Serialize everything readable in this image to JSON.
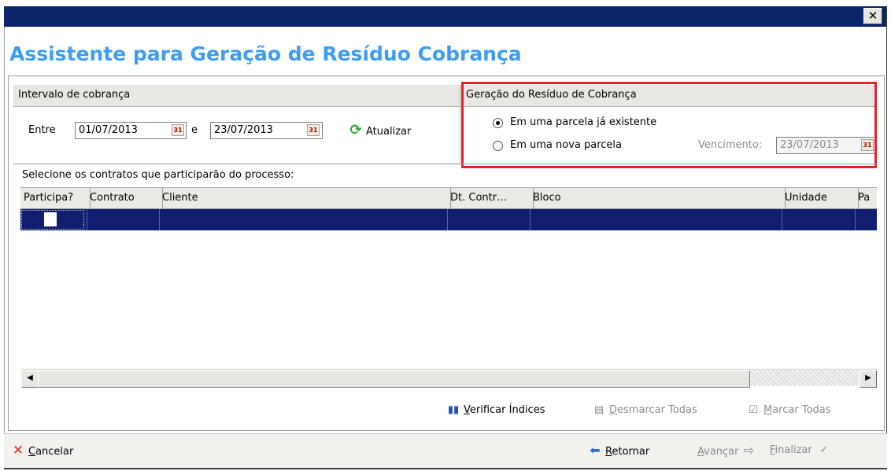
{
  "window": {
    "close_glyph": "✕"
  },
  "heading": "Assistente para Geração de Resíduo Cobrança",
  "intervalo": {
    "title": "Intervalo de cobrança",
    "entre_label": "Entre",
    "date_from": "01/07/2013",
    "e_label": "e",
    "date_to": "23/07/2013",
    "refresh_label": "Atualizar"
  },
  "geracao": {
    "title": "Geração do Resíduo de Cobrança",
    "option_existing": "Em uma parcela já existente",
    "option_new": "Em uma nova parcela",
    "selected": "existing",
    "vencimento_label": "Vencimento:",
    "vencimento_date": "23/07/2013"
  },
  "contratos": {
    "prompt": "Selecione os contratos que participarão do processo:",
    "columns": [
      "Participa?",
      "Contrato",
      "Cliente",
      "Dt. Contr…",
      "Bloco",
      "Unidade",
      "Pa"
    ]
  },
  "actions": {
    "verificar": {
      "pre": "",
      "accel": "V",
      "post": "erificar Índices"
    },
    "desmarcar": {
      "pre": "",
      "accel": "D",
      "post": "esmarcar Todas"
    },
    "marcar": {
      "pre": "",
      "accel": "M",
      "post": "arcar Todas"
    }
  },
  "footer": {
    "cancelar": {
      "pre": "",
      "accel": "C",
      "post": "ancelar"
    },
    "retornar": {
      "pre": "",
      "accel": "R",
      "post": "etornar"
    },
    "avancar": {
      "pre": "",
      "accel": "A",
      "post": "vançar"
    },
    "finalizar": {
      "pre": "",
      "accel": "F",
      "post": "inalizar"
    }
  },
  "colors": {
    "title_bar": "#0a246a",
    "heading": "#3d9df5",
    "highlight": "#e8202a",
    "selected_row": "#0f1e6e"
  }
}
